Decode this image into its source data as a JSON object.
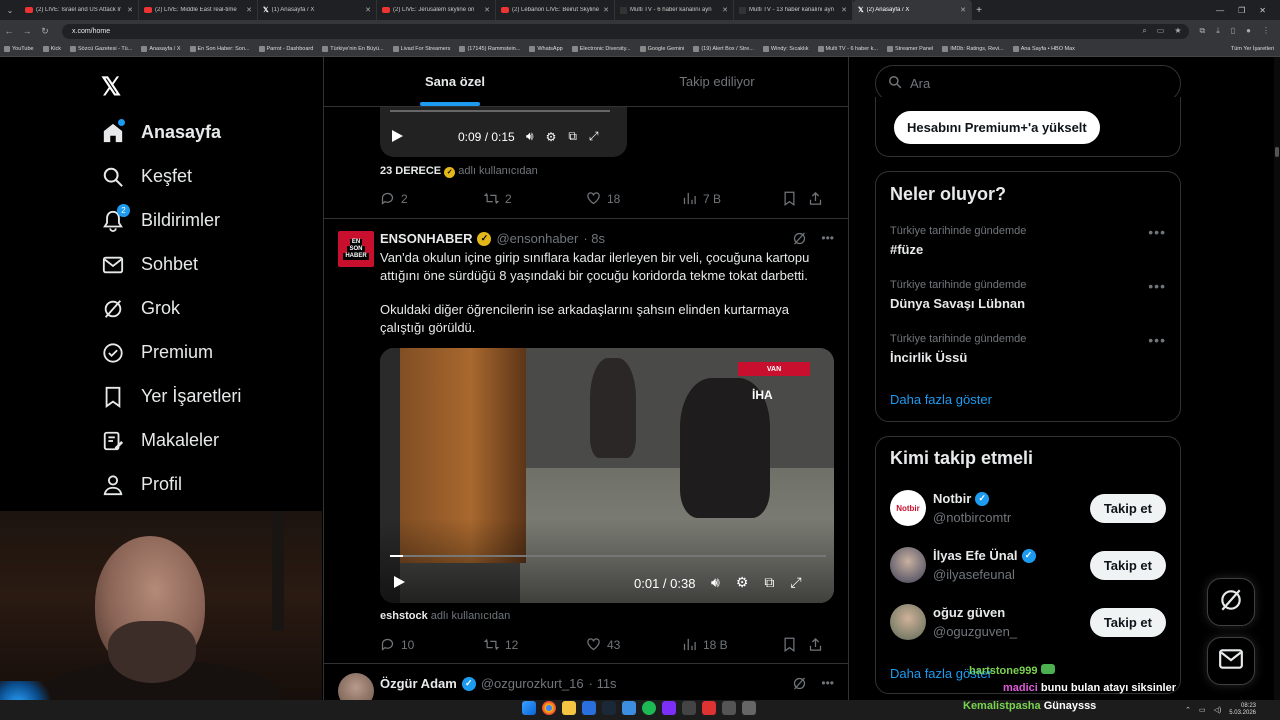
{
  "browser": {
    "tabs": [
      {
        "title": "(2) LIVE: Israel and US Attack Ir",
        "icon": "youtube-icon"
      },
      {
        "title": "(2) LIVE: Middle East real-time",
        "icon": "youtube-icon"
      },
      {
        "title": "(1) Anasayfa / X",
        "icon": "x-icon"
      },
      {
        "title": "(2) LIVE: Jerusalem skyline on",
        "icon": "youtube-icon"
      },
      {
        "title": "(2) Lebanon LIVE: Beirut Skyline",
        "icon": "youtube-icon"
      },
      {
        "title": "Multi TV - 6 haber kanalını ayn",
        "icon": "multitv-icon"
      },
      {
        "title": "Multi TV - 13 haber kanalını ayn",
        "icon": "multitv-icon"
      },
      {
        "title": "(2) Anasayfa / X",
        "icon": "x-icon",
        "active": true
      }
    ],
    "url": "x.com/home",
    "bookmarks": [
      "YouTube",
      "Kick",
      "Sözcü Gazetesi - Tü...",
      "Anasayfa / X",
      "En Son Haber: Son...",
      "Parrot - Dashboard",
      "Türkiye'nin En Büyü...",
      "Livad For Streamers",
      "(17145) Rammstein...",
      "WhatsApp",
      "Electronic Diversity...",
      "Google Gemini",
      "(19) Alert Box / Stre...",
      "Windy: Sıcaklık",
      "Multi TV - 6 haber k...",
      "Streamer Panel",
      "IMDb: Ratings, Revi...",
      "Ana Sayfa • HBO Max"
    ],
    "bookmarks_all": "Tüm Yer İşaretleri"
  },
  "nav": {
    "items": [
      {
        "label": "Anasayfa",
        "icon": "home-icon"
      },
      {
        "label": "Keşfet",
        "icon": "search-icon"
      },
      {
        "label": "Bildirimler",
        "icon": "bell-icon",
        "badge": "2"
      },
      {
        "label": "Sohbet",
        "icon": "mail-icon"
      },
      {
        "label": "Grok",
        "icon": "grok-icon"
      },
      {
        "label": "Premium",
        "icon": "premium-icon"
      },
      {
        "label": "Yer İşaretleri",
        "icon": "bookmark-icon"
      },
      {
        "label": "Makaleler",
        "icon": "article-icon"
      },
      {
        "label": "Profil",
        "icon": "profile-icon"
      }
    ]
  },
  "timeline": {
    "tabs": [
      "Sana özel",
      "Takip ediliyor"
    ],
    "post1": {
      "video_time": "0:09 / 0:15",
      "credit_name": "23 DERECE",
      "credit_suffix": "adlı kullanıcıdan",
      "replies": "2",
      "reposts": "2",
      "likes": "18",
      "views": "7 B"
    },
    "post2": {
      "avatar_text": [
        "EN",
        "SON",
        "HABER"
      ],
      "name": "ENSONHABER",
      "handle": "@ensonhaber",
      "time": "· 8s",
      "text1": "Van'da okulun içine girip sınıflara kadar ilerleyen bir veli, çocuğuna kartopu attığını öne sürdüğü 8 yaşındaki bir çocuğu koridorda tekme tokat darbetti.",
      "text2": "Okuldaki diğer öğrencilerin ise arkadaşlarını şahsın elinden kurtarmaya çalıştığı görüldü.",
      "video_badge": "VAN",
      "video_watermark": "İHA",
      "video_time": "0:01 / 0:38",
      "video_progress": 0.03,
      "credit_name": "eshstock",
      "credit_suffix": "adlı kullanıcıdan",
      "replies": "10",
      "reposts": "12",
      "likes": "43",
      "views": "18 B"
    },
    "post3": {
      "name": "Özgür Adam",
      "handle": "@ozgurozkurt_16",
      "time": "· 11s"
    }
  },
  "sidebar": {
    "search_placeholder": "Ara",
    "premium_button": "Hesabını Premium+'a yükselt",
    "trends_title": "Neler oluyor?",
    "trends": [
      {
        "context": "Türkiye tarihinde gündemde",
        "name": "#füze"
      },
      {
        "context": "Türkiye tarihinde gündemde",
        "name": "Dünya Savaşı Lübnan"
      },
      {
        "context": "Türkiye tarihinde gündemde",
        "name": "İncirlik Üssü"
      }
    ],
    "show_more": "Daha fazla göster",
    "wtf_title": "Kimi takip etmeli",
    "wtf": [
      {
        "name": "Notbir",
        "handle": "@notbircomtr",
        "avatar_text": "Notbir",
        "follow": "Takip et"
      },
      {
        "name": "İlyas Efe Ünal",
        "handle": "@ilyasefeunal",
        "follow": "Takip et"
      },
      {
        "name": "oğuz güven",
        "handle": "@oguzguven_",
        "follow": "Takip et"
      }
    ],
    "wtf_more": "Daha fazla göster"
  },
  "stream_chat": [
    {
      "user": "hartstone999",
      "msg": "",
      "color": "#7ad34f"
    },
    {
      "user": "madici",
      "msg": "bunu bulan atayı siksinler",
      "color": "#e05bd9"
    },
    {
      "user": "Kemalistpasha",
      "msg": "Günaysss",
      "color": "#7ad34f"
    }
  ],
  "taskbar": {
    "time": "08:23",
    "date": "5.03.2026"
  },
  "colors": {
    "accent": "#1d9bf0",
    "bg": "#000000",
    "border": "#2f3336"
  }
}
